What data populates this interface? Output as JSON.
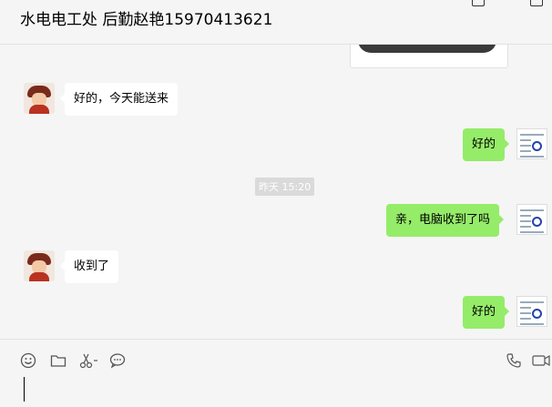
{
  "header": {
    "title": "水电电工处 后勤赵艳15970413621"
  },
  "messages": {
    "m1": "好的，今天能送来",
    "m2": "好的",
    "timestamp": "昨天 15:20",
    "m3": "亲，电脑收到了吗",
    "m4": "收到了",
    "m5": "好的"
  },
  "toolbar": {
    "emoji_icon": "emoji-icon",
    "folder_icon": "folder-icon",
    "scissors_icon": "scissors-icon",
    "chat_icon": "chat-bubble-icon",
    "phone_icon": "phone-icon",
    "video_icon": "video-icon"
  },
  "colors": {
    "outgoing": "#95ec69",
    "incoming": "#ffffff",
    "background": "#f5f5f5"
  }
}
